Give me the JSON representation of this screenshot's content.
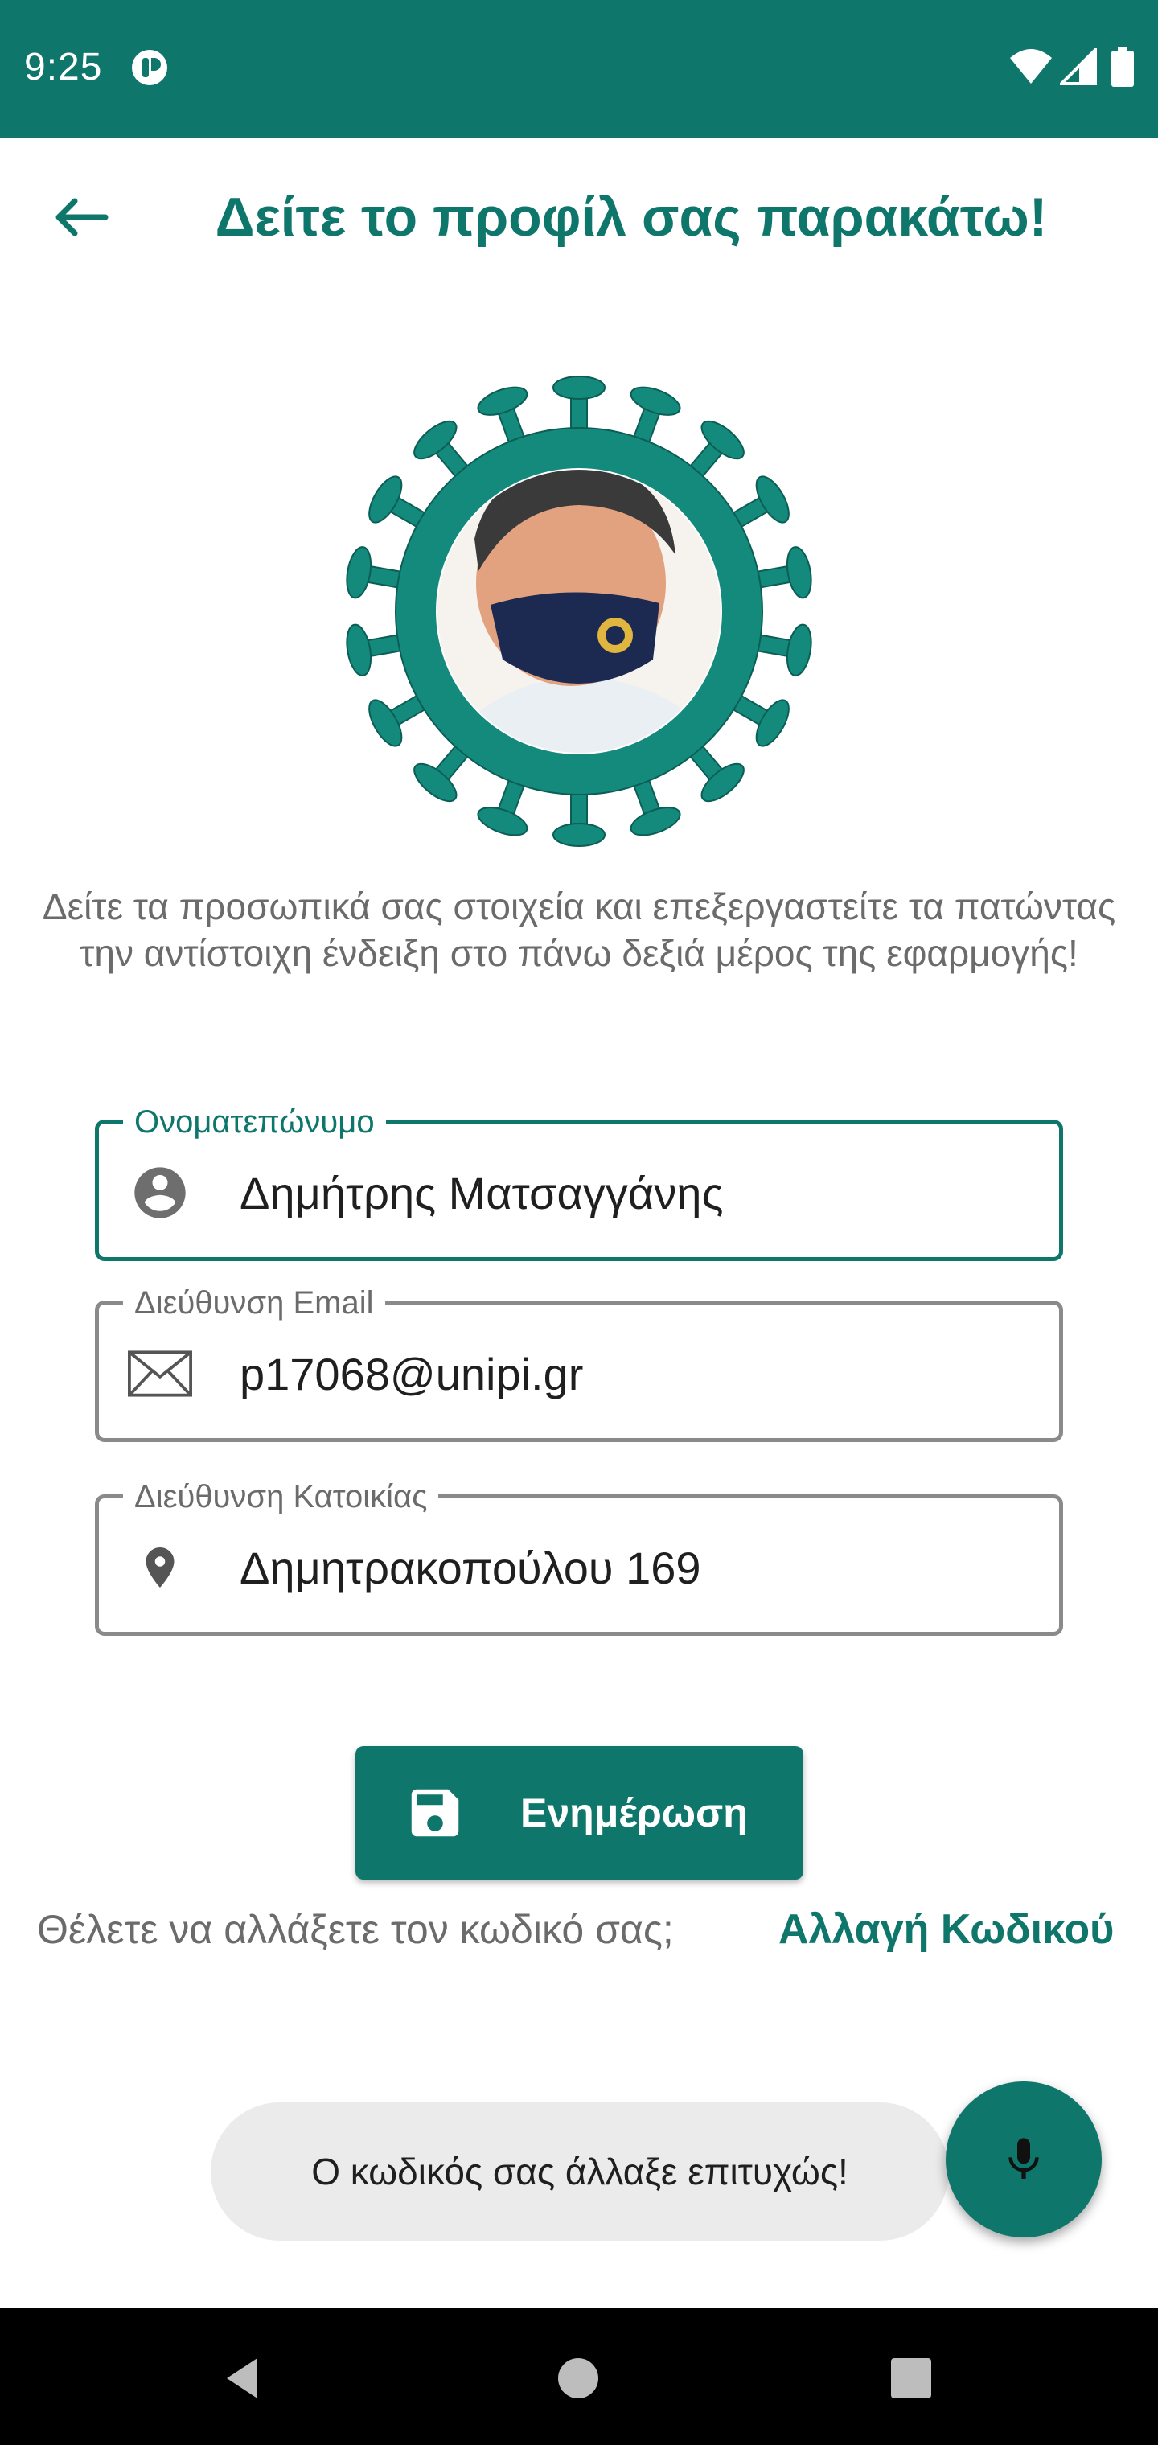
{
  "status_bar": {
    "time": "9:25"
  },
  "header": {
    "title": "Δείτε το προφίλ σας παρακάτω!"
  },
  "description": "Δείτε τα προσωπικά σας στοιχεία και επεξεργαστείτε τα πατώντας την αντίστοιχη ένδειξη στο πάνω δεξιά μέρος της εφαρμογής!",
  "fields": {
    "name": {
      "label": "Ονοματεπώνυμο",
      "value": "Δημήτρης Ματσαγγάνης",
      "icon": "account-circle-icon"
    },
    "email": {
      "label": "Διεύθυνση Email",
      "value": "p17068@unipi.gr",
      "icon": "email-icon"
    },
    "address": {
      "label": "Διεύθυνση Κατοικίας",
      "value": "Δημητρακοπούλου 169",
      "icon": "location-pin-icon"
    }
  },
  "update_button": {
    "label": "Ενημέρωση",
    "icon": "save-icon"
  },
  "password": {
    "question": "Θέλετε να αλλάξετε τον κωδικό σας;",
    "link": "Αλλαγή Κωδικού"
  },
  "toast": {
    "text": "Ο κωδικός σας άλλαξε επιτυχώς!"
  },
  "fab": {
    "icon": "microphone-icon"
  },
  "colors": {
    "primary": "#0E766B",
    "field_border": "#8A8A8A",
    "secondary_text": "#6B6B6B",
    "toast_bg": "#EBEBEB"
  }
}
